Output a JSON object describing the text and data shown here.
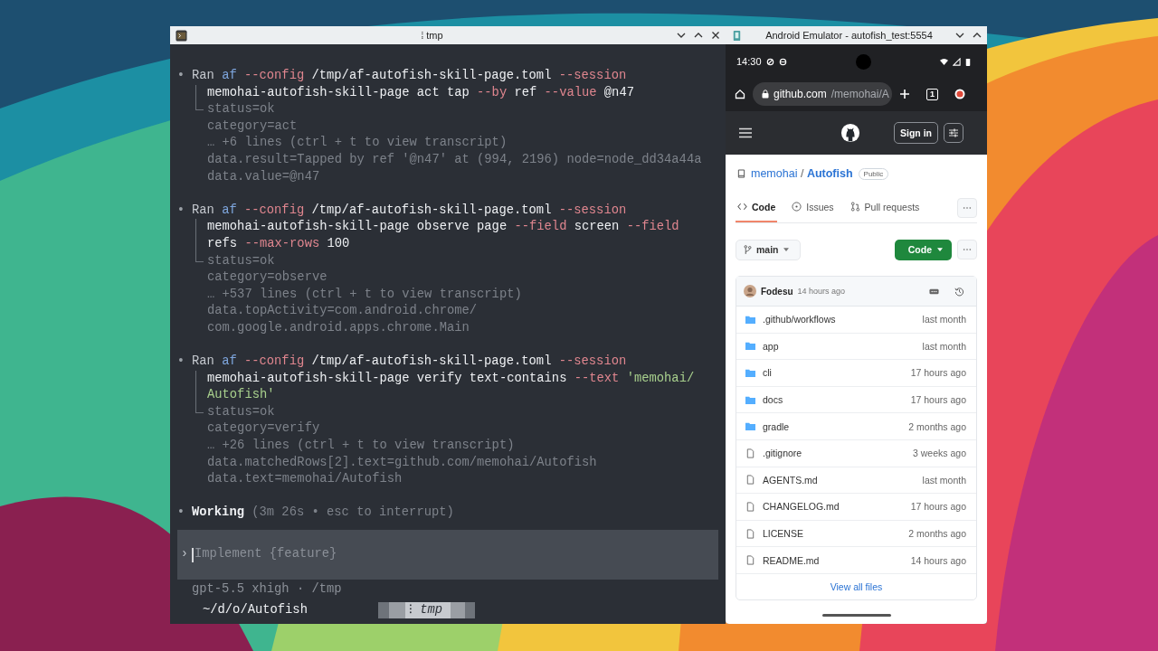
{
  "terminal": {
    "title": "tmp",
    "title_mark": "⁞",
    "entries": [
      {
        "bullet": "•",
        "command_lines": [
          [
            {
              "text": "Ran ",
              "kind": "plain"
            },
            {
              "text": "af",
              "kind": "cmd"
            },
            {
              "text": " --config",
              "kind": "flag"
            },
            {
              "text": " /tmp/af-autofish-skill-page.toml ",
              "kind": "bright"
            },
            {
              "text": "--session",
              "kind": "flag"
            }
          ],
          [
            {
              "text": "memohai-autofish-skill-page act tap ",
              "kind": "bright"
            },
            {
              "text": "--by",
              "kind": "flag"
            },
            {
              "text": " ref ",
              "kind": "bright"
            },
            {
              "text": "--value",
              "kind": "flag"
            },
            {
              "text": " @n47",
              "kind": "bright"
            }
          ]
        ],
        "output_lines": [
          "status=ok",
          "category=act",
          "… +6 lines (ctrl + t to view transcript)",
          "data.result=Tapped by ref '@n47' at (994, 2196) node=node_dd34a44a",
          "data.value=@n47"
        ]
      },
      {
        "bullet": "•",
        "command_lines": [
          [
            {
              "text": "Ran ",
              "kind": "plain"
            },
            {
              "text": "af",
              "kind": "cmd"
            },
            {
              "text": " --config",
              "kind": "flag"
            },
            {
              "text": " /tmp/af-autofish-skill-page.toml ",
              "kind": "bright"
            },
            {
              "text": "--session",
              "kind": "flag"
            }
          ],
          [
            {
              "text": "memohai-autofish-skill-page observe page ",
              "kind": "bright"
            },
            {
              "text": "--field",
              "kind": "flag"
            },
            {
              "text": " screen ",
              "kind": "bright"
            },
            {
              "text": "--field",
              "kind": "flag"
            }
          ],
          [
            {
              "text": "refs ",
              "kind": "bright"
            },
            {
              "text": "--max-rows",
              "kind": "flag"
            },
            {
              "text": " 100",
              "kind": "bright"
            }
          ]
        ],
        "output_lines": [
          "status=ok",
          "category=observe",
          "… +537 lines (ctrl + t to view transcript)",
          "data.topActivity=com.android.chrome/",
          "com.google.android.apps.chrome.Main"
        ]
      },
      {
        "bullet": "•",
        "command_lines": [
          [
            {
              "text": "Ran ",
              "kind": "plain"
            },
            {
              "text": "af",
              "kind": "cmd"
            },
            {
              "text": " --config",
              "kind": "flag"
            },
            {
              "text": " /tmp/af-autofish-skill-page.toml ",
              "kind": "bright"
            },
            {
              "text": "--session",
              "kind": "flag"
            }
          ],
          [
            {
              "text": "memohai-autofish-skill-page verify text-contains ",
              "kind": "bright"
            },
            {
              "text": "--text",
              "kind": "flag"
            },
            {
              "text": " 'memohai/",
              "kind": "string"
            }
          ],
          [
            {
              "text": "Autofish'",
              "kind": "string"
            }
          ]
        ],
        "output_lines": [
          "status=ok",
          "category=verify",
          "… +26 lines (ctrl + t to view transcript)",
          "data.matchedRows[2].text=github.com/memohai/Autofish",
          "data.text=memohai/Autofish"
        ]
      }
    ],
    "working": {
      "bullet": "•",
      "label": "Working",
      "detail": "(3m 26s • esc to interrupt)"
    },
    "prompt": {
      "marker": "›",
      "placeholder": "Implement {feature}"
    },
    "status": "gpt-5.5 xhigh · /tmp",
    "tmux": {
      "path": "~/d/o/Autofish",
      "tab_mark": "⁝",
      "tab": "tmp"
    }
  },
  "emulator": {
    "title": "Android Emulator - autofish_test:5554",
    "time": "14:30",
    "url_host": "github.com",
    "url_path": "/memohai/A",
    "tab_count": "1",
    "sign_in": "Sign in",
    "owner": "memohai",
    "separator": "/",
    "repo": "Autofish",
    "visibility": "Public",
    "tabs": [
      {
        "label": "Code",
        "selected": true
      },
      {
        "label": "Issues",
        "selected": false
      },
      {
        "label": "Pull requests",
        "selected": false
      }
    ],
    "branch": "main",
    "code_button": "Code",
    "commit": {
      "author": "Fodesu",
      "time": "14 hours ago"
    },
    "files": [
      {
        "kind": "folder",
        "name": ".github/workflows",
        "time": "last month"
      },
      {
        "kind": "folder",
        "name": "app",
        "time": "last month"
      },
      {
        "kind": "folder",
        "name": "cli",
        "time": "17 hours ago"
      },
      {
        "kind": "folder",
        "name": "docs",
        "time": "17 hours ago"
      },
      {
        "kind": "folder",
        "name": "gradle",
        "time": "2 months ago"
      },
      {
        "kind": "file",
        "name": ".gitignore",
        "time": "3 weeks ago"
      },
      {
        "kind": "file",
        "name": "AGENTS.md",
        "time": "last month"
      },
      {
        "kind": "file",
        "name": "CHANGELOG.md",
        "time": "17 hours ago"
      },
      {
        "kind": "file",
        "name": "LICENSE",
        "time": "2 months ago"
      },
      {
        "kind": "file",
        "name": "README.md",
        "time": "14 hours ago"
      }
    ],
    "view_all": "View all files"
  }
}
